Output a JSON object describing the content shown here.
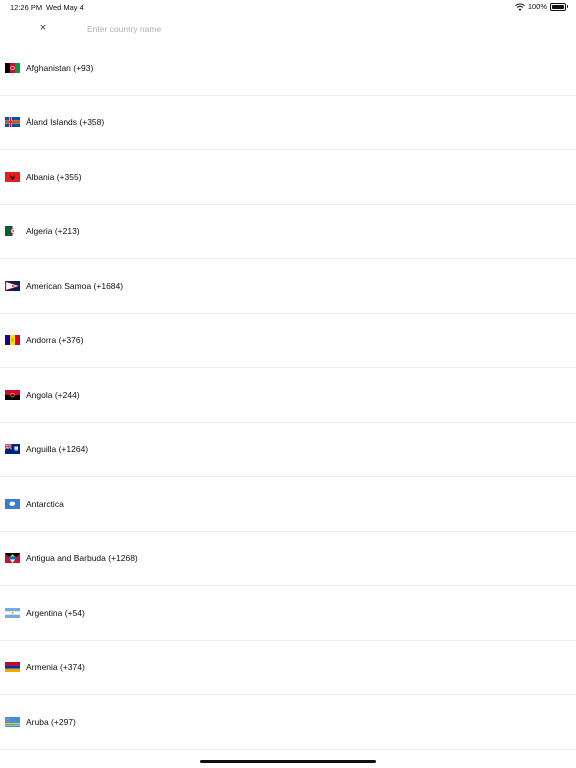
{
  "status_bar": {
    "time": "12:26 PM",
    "date": "Wed May 4",
    "battery_percent": "100%",
    "battery_level": 1.0,
    "icons": [
      "wifi-icon",
      "battery-icon"
    ]
  },
  "search": {
    "close_symbol": "×",
    "placeholder": "Enter country name",
    "value": ""
  },
  "countries": [
    {
      "label": "Afghanistan (+93)",
      "flag": "afghanistan-flag-icon"
    },
    {
      "label": "Åland Islands (+358)",
      "flag": "aland-islands-flag-icon"
    },
    {
      "label": "Albania (+355)",
      "flag": "albania-flag-icon"
    },
    {
      "label": "Algeria (+213)",
      "flag": "algeria-flag-icon"
    },
    {
      "label": "American Samoa (+1684)",
      "flag": "american-samoa-flag-icon"
    },
    {
      "label": "Andorra (+376)",
      "flag": "andorra-flag-icon"
    },
    {
      "label": "Angola (+244)",
      "flag": "angola-flag-icon"
    },
    {
      "label": "Anguilla (+1264)",
      "flag": "anguilla-flag-icon"
    },
    {
      "label": "Antarctica",
      "flag": "antarctica-flag-icon"
    },
    {
      "label": "Antigua and Barbuda (+1268)",
      "flag": "antigua-and-barbuda-flag-icon"
    },
    {
      "label": "Argentina (+54)",
      "flag": "argentina-flag-icon"
    },
    {
      "label": "Armenia (+374)",
      "flag": "armenia-flag-icon"
    },
    {
      "label": "Aruba (+297)",
      "flag": "aruba-flag-icon"
    }
  ]
}
